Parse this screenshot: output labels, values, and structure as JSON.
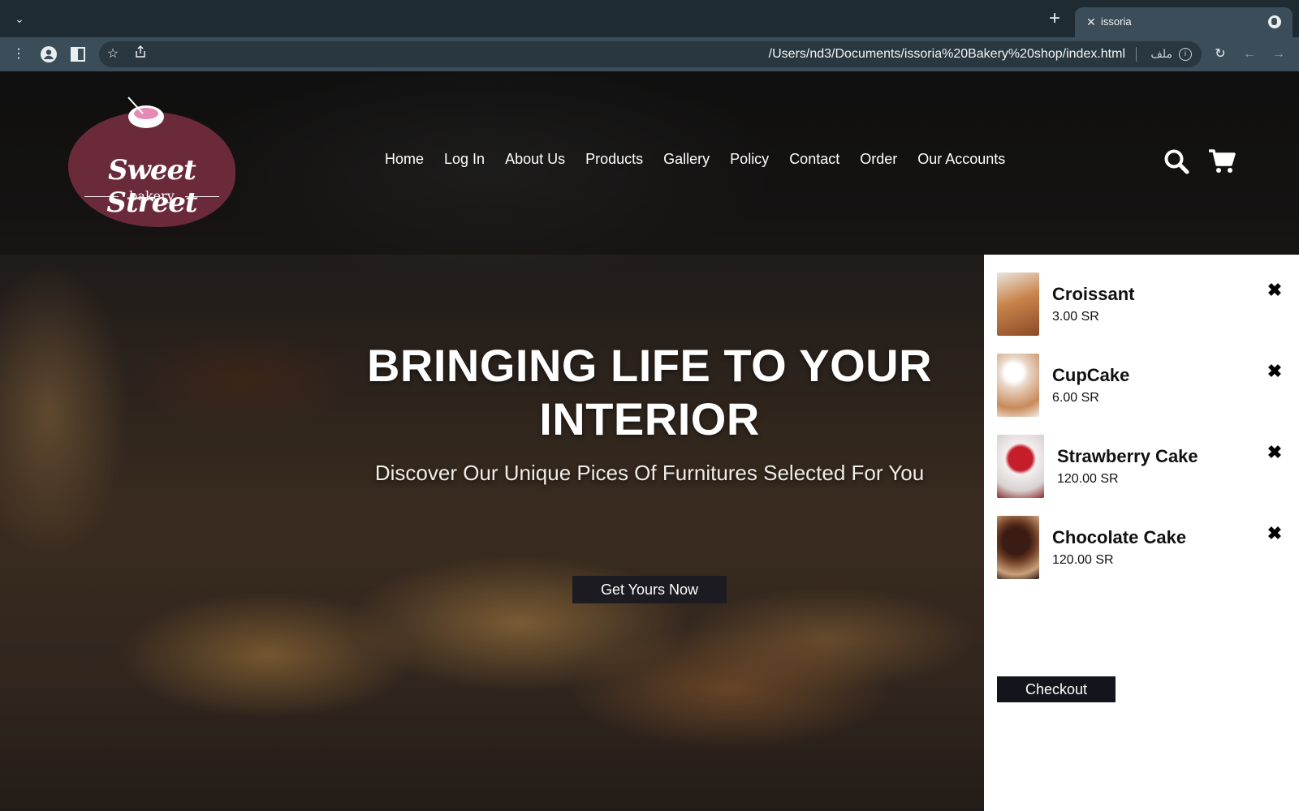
{
  "browser": {
    "tab_title": "issoria",
    "url": "/Users/nd3/Documents/issoria%20Bakery%20shop/index.html",
    "url_scheme_label": "ملف",
    "icons": [
      "tab-dropdown-icon",
      "new-tab-icon",
      "tab-close-icon",
      "globe-icon",
      "kebab-menu-icon",
      "profile-icon",
      "side-panel-icon",
      "bookmark-star-icon",
      "share-icon",
      "info-icon",
      "reload-icon",
      "back-arrow-icon",
      "forward-arrow-icon"
    ]
  },
  "site": {
    "logo": {
      "main": "Sweet Street",
      "sub": "bakery"
    },
    "nav": [
      "Home",
      "Log In",
      "About Us",
      "Products",
      "Gallery",
      "Policy",
      "Contact",
      "Order",
      "Our Accounts"
    ],
    "icons": [
      "search-icon",
      "cart-icon"
    ]
  },
  "hero": {
    "title_line1": "BRINGING LIFE TO YOUR",
    "title_line2": "INTERIOR",
    "subtitle": "Discover Our Unique Pices Of Furnitures Selected For You",
    "cta": "Get Yours Now"
  },
  "cart": {
    "items": [
      {
        "name": "Croissant",
        "price": "3.00 SR"
      },
      {
        "name": "CupCake",
        "price": "6.00 SR"
      },
      {
        "name": "Strawberry Cake",
        "price": "120.00 SR"
      },
      {
        "name": "Chocolate Cake",
        "price": "120.00 SR"
      }
    ],
    "checkout_label": "Checkout"
  },
  "colors": {
    "browser_tabbar": "#1f2b33",
    "browser_toolbar": "#3b4d58",
    "logo_background": "#6a2a3a",
    "button_dark": "#1c1b22"
  }
}
